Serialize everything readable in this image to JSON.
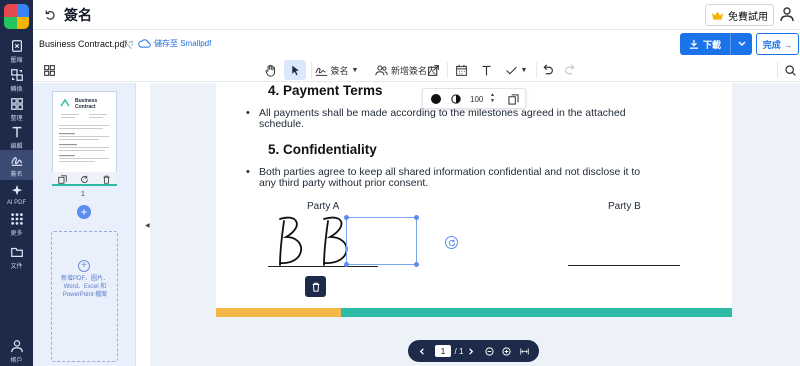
{
  "nav": {
    "items": [
      {
        "label": "壓縮",
        "icon": "compress-icon"
      },
      {
        "label": "轉換",
        "icon": "convert-icon"
      },
      {
        "label": "整理",
        "icon": "organize-icon"
      },
      {
        "label": "編輯",
        "icon": "edit-text-icon"
      },
      {
        "label": "簽名",
        "icon": "sign-icon"
      },
      {
        "label": "AI PDF",
        "icon": "ai-icon"
      },
      {
        "label": "更多",
        "icon": "grid-icon"
      },
      {
        "label": "文件",
        "icon": "folder-icon"
      },
      {
        "label": "帳戶",
        "icon": "account-icon"
      }
    ]
  },
  "header": {
    "title": "簽名",
    "trial_label": "免費試用"
  },
  "filebar": {
    "filename": "Business Contract.pdf",
    "cloud_save": "儲存至 Smallpdf",
    "download_label": "下載",
    "done_label": "完成 →"
  },
  "toolbar": {
    "sign_label": "簽名",
    "add_signer_label": "新增簽名人"
  },
  "thumbs": {
    "page_number": "1",
    "doc_title_line1": "Business",
    "doc_title_line2": "Contract",
    "add_files_text": "新增PDF、圖片、Word、Excel 和 PowerPoint 檔案"
  },
  "document": {
    "section4_title": "4. Payment Terms",
    "section4_bullet_line1": "All  payments  shall  be  made  according  to  the  milestones  agreed  in  the  attached",
    "section4_bullet_line2": "schedule.",
    "section5_title": "5. Confidentiality",
    "section5_bullet_line1": "Both  parties  agree  to  keep  all  shared  information  confidential  and  not  disclose  it  to",
    "section5_bullet_line2": "any third party without prior consent.",
    "party_a": "Party A",
    "party_b": "Party B"
  },
  "format_bar": {
    "opacity_value": "100",
    "color": "#111111"
  },
  "pager": {
    "current_page": "1",
    "total_pages": "/ 1"
  },
  "colors": {
    "nav_bg": "#1e2a4a",
    "accent": "#1a73e8",
    "bar_yellow": "#f5b848",
    "bar_teal": "#2ebba6"
  }
}
